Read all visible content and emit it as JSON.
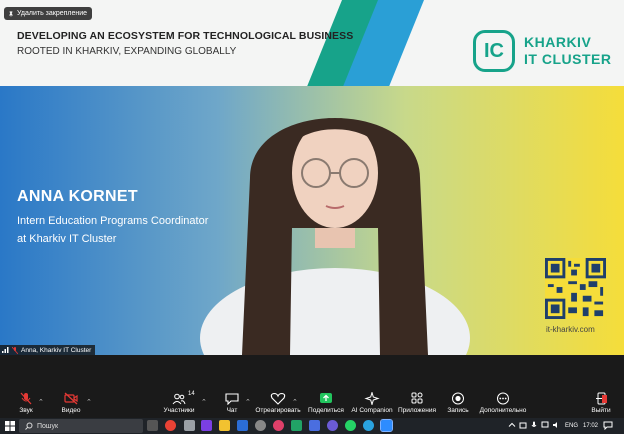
{
  "unpin_label": "Удалить закрепление",
  "banner": {
    "title": "DEVELOPING AN ECOSYSTEM FOR TECHNOLOGICAL BUSINESS",
    "subtitle": "ROOTED IN KHARKIV, EXPANDING GLOBALLY",
    "logo_mark": "IC",
    "logo_line1": "KHARKIV",
    "logo_line2": "IT CLUSTER"
  },
  "speaker": {
    "name": "ANNA KORNET",
    "role_line1": "Intern Education Programs Coordinator",
    "role_line2": "at Kharkiv IT Cluster"
  },
  "qr_url": "it-kharkiv.com",
  "participant_tag": "Anna, Kharkiv IT Cluster",
  "toolbar": {
    "audio": "Звук",
    "video": "Видео",
    "participants": "Участники",
    "participants_count": "14",
    "chat": "Чат",
    "react": "Отреагировать",
    "share": "Поделиться",
    "ai": "AI Companion",
    "apps": "Приложения",
    "record": "Запись",
    "more": "Дополнительно",
    "leave": "Выйти"
  },
  "taskbar": {
    "search_placeholder": "Пошук",
    "lang": "ENG",
    "time": "17:02"
  },
  "colors": {
    "brand_teal": "#17a38a",
    "brand_blue": "#2a9fd6",
    "share_green": "#22c55e",
    "mute_red": "#e53935"
  }
}
